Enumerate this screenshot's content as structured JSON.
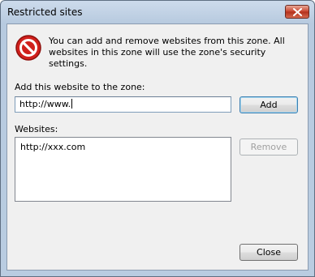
{
  "window": {
    "title": "Restricted sites"
  },
  "info": {
    "icon": "stop-icon",
    "message": "You can add and remove websites from this zone. All websites in this zone will use the zone's security settings."
  },
  "add_section": {
    "label": "Add this website to the zone:",
    "input_value": "http://www.",
    "add_button": "Add"
  },
  "websites_section": {
    "label": "Websites:",
    "items": [
      "http://xxx.com"
    ],
    "remove_button": "Remove"
  },
  "footer": {
    "close_button": "Close"
  },
  "colors": {
    "stop_icon": "#d0201c",
    "input_border": "#7f9db9",
    "dialog_background": "#f0f0f0"
  }
}
